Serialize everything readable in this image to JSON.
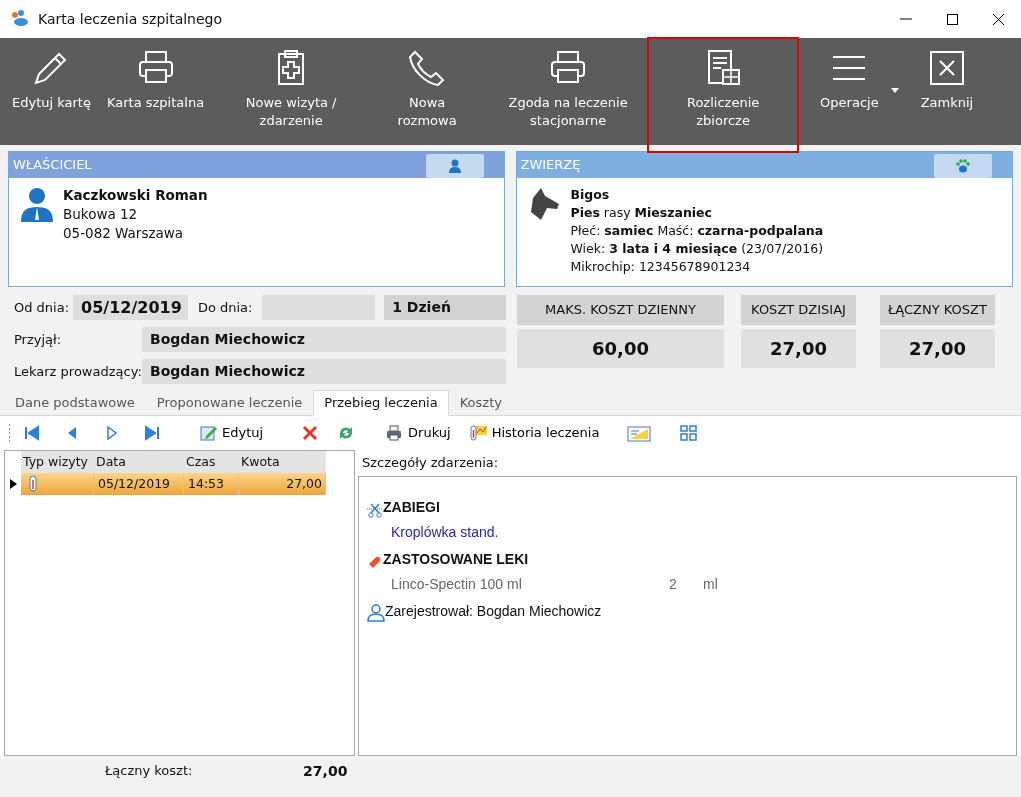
{
  "window": {
    "title": "Karta leczenia szpitalnego"
  },
  "toolbar": [
    {
      "label": "Edytuj kartę",
      "highlighted": false,
      "dropdown": false
    },
    {
      "label": "Karta szpitalna",
      "highlighted": false,
      "dropdown": false
    },
    {
      "label": "Nowe wizyta / zdarzenie",
      "highlighted": false,
      "dropdown": false
    },
    {
      "label": "Nowa rozmowa",
      "highlighted": false,
      "dropdown": false
    },
    {
      "label": "Zgoda na leczenie stacjonarne",
      "highlighted": false,
      "dropdown": false
    },
    {
      "label": "Rozliczenie zbiorcze",
      "highlighted": true,
      "dropdown": false
    },
    {
      "label": "Operacje",
      "highlighted": false,
      "dropdown": true
    },
    {
      "label": "Zamknij",
      "highlighted": false,
      "dropdown": false
    }
  ],
  "owner": {
    "header": "WŁAŚCICIEL",
    "name": "Kaczkowski Roman",
    "lines": [
      "Bukowa 12",
      "05-082  Warszawa"
    ]
  },
  "animal": {
    "header": "ZWIERZĘ",
    "name": "Bigos",
    "lines": [
      "**Pies** rasy **Mieszaniec**",
      "Płeć: **samiec**  Maść: **czarna-podpalana**",
      "Wiek: **3 lata i 4 miesiące** (23/07/2016)",
      "Mikrochip: 12345678901234"
    ]
  },
  "dates": {
    "from_label": "Od dnia:",
    "from_value": "05/12/2019",
    "to_label": "Do dnia:",
    "duration": "1 Dzień"
  },
  "staff": [
    {
      "label": "Przyjął:",
      "value": "Bogdan Miechowicz"
    },
    {
      "label": "Lekarz prowadzący:",
      "value": "Bogdan Miechowicz"
    }
  ],
  "costs": [
    {
      "label": "MAKS. KOSZT DZIENNY",
      "value": "60,00"
    },
    {
      "label": "KOSZT DZISIAJ",
      "value": "27,00"
    },
    {
      "label": "ŁĄCZNY KOSZT",
      "value": "27,00"
    }
  ],
  "tabs": [
    {
      "label": "Dane podstawowe",
      "selected": false
    },
    {
      "label": "Proponowane leczenie",
      "selected": false
    },
    {
      "label": "Przebieg leczenia",
      "selected": true
    },
    {
      "label": "Koszty",
      "selected": false
    }
  ],
  "subtoolbar": [
    {
      "kind": "icon"
    },
    {
      "kind": "icon"
    },
    {
      "kind": "icon"
    },
    {
      "kind": "icon"
    },
    {
      "kind": "text",
      "label": "Edytuj"
    },
    {
      "kind": "icon"
    },
    {
      "kind": "icon"
    },
    {
      "kind": "text",
      "label": "Drukuj"
    },
    {
      "kind": "text",
      "label": "Historia leczenia"
    },
    {
      "kind": "icon"
    },
    {
      "kind": "icon"
    }
  ],
  "table": {
    "columns": [
      "Typ wizyty",
      "Data",
      "Czas",
      "Kwota"
    ],
    "rows": [
      {
        "selected": true,
        "date": "05/12/2019",
        "time": "14:53",
        "amount": "27,00"
      }
    ]
  },
  "details": {
    "label": "Szczegóły zdarzenia:",
    "sections": [
      {
        "kind": "procedures",
        "title": "ZABIEGI",
        "items": [
          {
            "name": "Kroplówka stand."
          }
        ]
      },
      {
        "kind": "drugs",
        "title": "ZASTOSOWANE LEKI",
        "items": [
          {
            "name": "Linco-Spectin 100 ml",
            "qty": "2",
            "unit": "ml"
          }
        ]
      }
    ],
    "registered": "Zarejestrował: Bogdan Miechowicz"
  },
  "footer": {
    "label": "Łączny koszt:",
    "value": "27,00"
  }
}
